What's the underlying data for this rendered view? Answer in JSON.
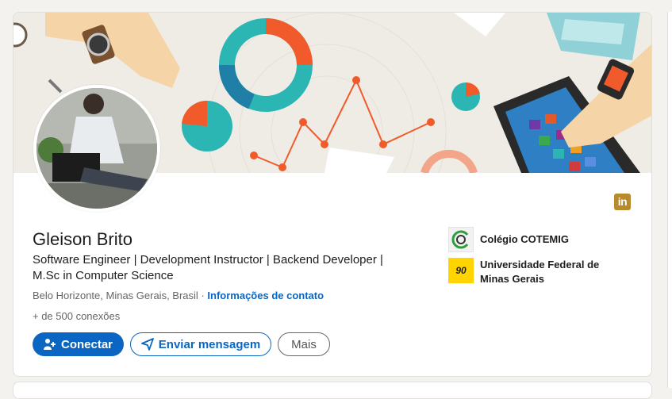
{
  "profile": {
    "name": "Gleison Brito",
    "headline": "Software Engineer | Development Instructor | Backend Developer | M.Sc in Computer Science",
    "location": "Belo Horizonte, Minas Gerais, Brasil",
    "separator": "·",
    "contact_info_link": "Informações de contato",
    "connections": "+ de 500 conexões"
  },
  "badge": {
    "text": "in",
    "icon": "linkedin-icon"
  },
  "actions": {
    "connect_label": "Conectar",
    "message_label": "Enviar mensagem",
    "more_label": "Mais"
  },
  "education": [
    {
      "name": "Colégio COTEMIG",
      "logo": "cotemig-logo"
    },
    {
      "name": "Universidade Federal de Minas Gerais",
      "logo": "ufmg-logo",
      "logo_text": "90"
    }
  ],
  "colors": {
    "primary": "#0a66c2",
    "cover_bg": "#efece6",
    "teal": "#2bb5b3",
    "orange": "#f15a2b",
    "badge": "#b88a2e"
  }
}
